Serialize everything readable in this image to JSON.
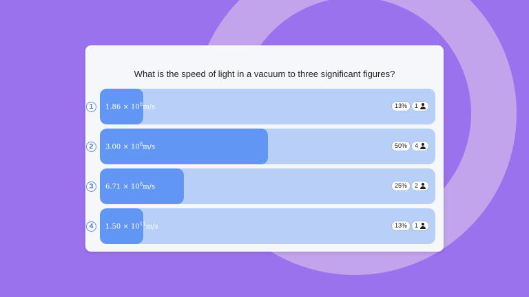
{
  "question": "What is the speed of light in a vacuum to three significant figures?",
  "options": [
    {
      "number": "1",
      "answer_base": "1.86 × 10",
      "answer_exp": "8",
      "answer_unit": "m/s",
      "percent_label": "13%",
      "percent_value": 0.13,
      "votes": "1"
    },
    {
      "number": "2",
      "answer_base": "3.00 × 10",
      "answer_exp": "8",
      "answer_unit": "m/s",
      "percent_label": "50%",
      "percent_value": 0.5,
      "votes": "4"
    },
    {
      "number": "3",
      "answer_base": "6.71 × 10",
      "answer_exp": "8",
      "answer_unit": "m/s",
      "percent_label": "25%",
      "percent_value": 0.25,
      "votes": "2"
    },
    {
      "number": "4",
      "answer_base": "1.50 × 10",
      "answer_exp": "11",
      "answer_unit": "m/s",
      "percent_label": "13%",
      "percent_value": 0.13,
      "votes": "1"
    }
  ],
  "colors": {
    "background": "#9b72ee",
    "track": "#b8cff8",
    "fill": "#6196f4"
  },
  "icons": {
    "voters": "user-icon"
  }
}
